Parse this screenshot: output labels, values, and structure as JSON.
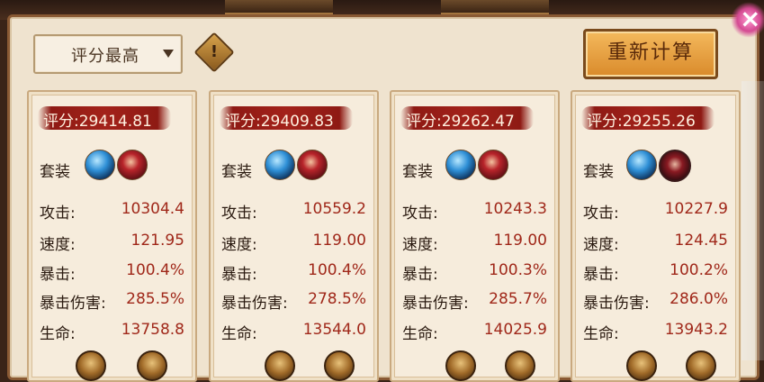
{
  "toolbar": {
    "sort_label": "评分最高",
    "info_glyph": "!",
    "recalc_label": "重新计算",
    "close_glyph": "×"
  },
  "cards": [
    {
      "score": "评分:29414.81",
      "set_label": "套装",
      "souls": [
        "blue",
        "red"
      ],
      "stats": [
        {
          "label": "攻击:",
          "value": "10304.4"
        },
        {
          "label": "速度:",
          "value": "121.95"
        },
        {
          "label": "暴击:",
          "value": "100.4%"
        },
        {
          "label": "暴击伤害:",
          "value": "285.5%"
        },
        {
          "label": "生命:",
          "value": "13758.8"
        }
      ]
    },
    {
      "score": "评分:29409.83",
      "set_label": "套装",
      "souls": [
        "blue",
        "red"
      ],
      "stats": [
        {
          "label": "攻击:",
          "value": "10559.2"
        },
        {
          "label": "速度:",
          "value": "119.00"
        },
        {
          "label": "暴击:",
          "value": "100.4%"
        },
        {
          "label": "暴击伤害:",
          "value": "278.5%"
        },
        {
          "label": "生命:",
          "value": "13544.0"
        }
      ]
    },
    {
      "score": "评分:29262.47",
      "set_label": "套装",
      "souls": [
        "blue",
        "red"
      ],
      "stats": [
        {
          "label": "攻击:",
          "value": "10243.3"
        },
        {
          "label": "速度:",
          "value": "119.00"
        },
        {
          "label": "暴击:",
          "value": "100.3%"
        },
        {
          "label": "暴击伤害:",
          "value": "285.7%"
        },
        {
          "label": "生命:",
          "value": "14025.9"
        }
      ]
    },
    {
      "score": "评分:29255.26",
      "set_label": "套装",
      "souls": [
        "blue",
        "redhat"
      ],
      "stats": [
        {
          "label": "攻击:",
          "value": "10227.9"
        },
        {
          "label": "速度:",
          "value": "124.45"
        },
        {
          "label": "暴击:",
          "value": "100.2%"
        },
        {
          "label": "暴击伤害:",
          "value": "286.0%"
        },
        {
          "label": "生命:",
          "value": "13943.2"
        }
      ]
    }
  ],
  "icons": {
    "soul_set_icon": "soul-portrait-icon",
    "bottom_icons": "equipment-slot-icon"
  }
}
